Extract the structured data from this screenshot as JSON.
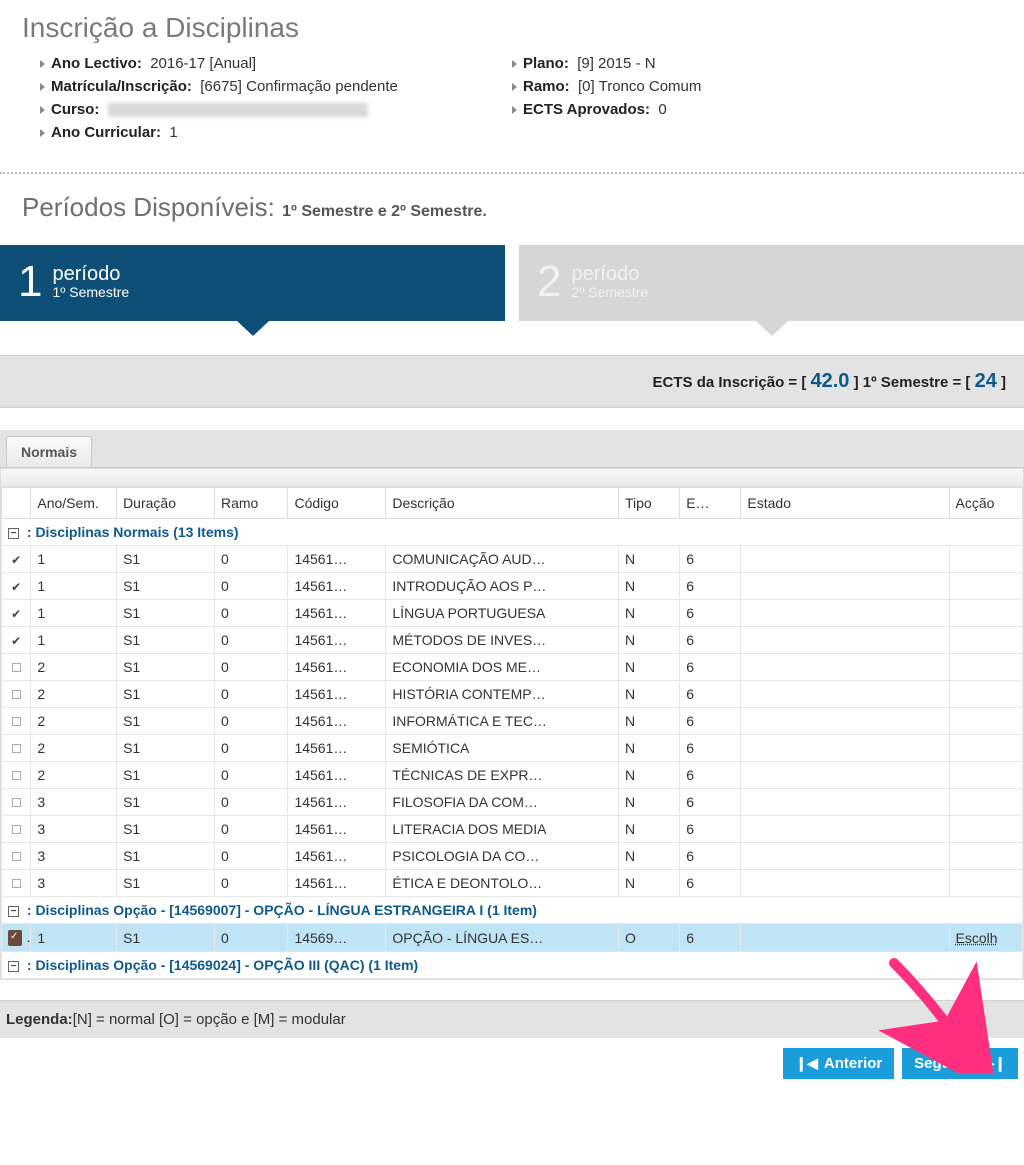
{
  "title": "Inscrição a Disciplinas",
  "info": {
    "left": {
      "ano_lectivo_label": "Ano Lectivo:",
      "ano_lectivo_value": "2016-17 [Anual]",
      "matricula_label": "Matrícula/Inscrição:",
      "matricula_value": "[6675] Confirmação pendente",
      "curso_label": "Curso:",
      "ano_curricular_label": "Ano Curricular:",
      "ano_curricular_value": "1"
    },
    "right": {
      "plano_label": "Plano:",
      "plano_value": "[9] 2015 - N",
      "ramo_label": "Ramo:",
      "ramo_value": "[0] Tronco Comum",
      "ects_aprov_label": "ECTS Aprovados:",
      "ects_aprov_value": "0"
    }
  },
  "periodos": {
    "label": "Períodos Disponíveis:",
    "text": "1º Semestre e 2º Semestre."
  },
  "tabs": [
    {
      "num": "1",
      "label": "período",
      "sub": "1º Semestre",
      "active": true
    },
    {
      "num": "2",
      "label": "período",
      "sub": "2º Semestre",
      "active": false
    }
  ],
  "ects_bar": {
    "label1": "ECTS da Inscrição = [",
    "val1": "42.0",
    "label2": "] 1º Semestre = [",
    "val2": "24",
    "label3": "]"
  },
  "subtab": "Normais",
  "columns": [
    "Ano/Sem.",
    "Duração",
    "Ramo",
    "Código",
    "Descrição",
    "Tipo",
    "E…",
    "Estado",
    "Acção"
  ],
  "groups": [
    {
      "title": ": Disciplinas Normais (13 Items)",
      "rows": [
        {
          "sel": true,
          "ano": "1",
          "dur": "S1",
          "ramo": "0",
          "cod": "14561…",
          "desc": "COMUNICAÇÃO AUD…",
          "tipo": "N",
          "ects": "6",
          "estado": "",
          "accao": ""
        },
        {
          "sel": true,
          "ano": "1",
          "dur": "S1",
          "ramo": "0",
          "cod": "14561…",
          "desc": "INTRODUÇÃO AOS P…",
          "tipo": "N",
          "ects": "6",
          "estado": "",
          "accao": ""
        },
        {
          "sel": true,
          "ano": "1",
          "dur": "S1",
          "ramo": "0",
          "cod": "14561…",
          "desc": "LÍNGUA PORTUGUESA",
          "tipo": "N",
          "ects": "6",
          "estado": "",
          "accao": ""
        },
        {
          "sel": true,
          "ano": "1",
          "dur": "S1",
          "ramo": "0",
          "cod": "14561…",
          "desc": "MÉTODOS DE INVES…",
          "tipo": "N",
          "ects": "6",
          "estado": "",
          "accao": ""
        },
        {
          "sel": false,
          "ano": "2",
          "dur": "S1",
          "ramo": "0",
          "cod": "14561…",
          "desc": "ECONOMIA DOS ME…",
          "tipo": "N",
          "ects": "6",
          "estado": "",
          "accao": ""
        },
        {
          "sel": false,
          "ano": "2",
          "dur": "S1",
          "ramo": "0",
          "cod": "14561…",
          "desc": "HISTÓRIA CONTEMP…",
          "tipo": "N",
          "ects": "6",
          "estado": "",
          "accao": ""
        },
        {
          "sel": false,
          "ano": "2",
          "dur": "S1",
          "ramo": "0",
          "cod": "14561…",
          "desc": "INFORMÁTICA E TEC…",
          "tipo": "N",
          "ects": "6",
          "estado": "",
          "accao": ""
        },
        {
          "sel": false,
          "ano": "2",
          "dur": "S1",
          "ramo": "0",
          "cod": "14561…",
          "desc": "SEMIÓTICA",
          "tipo": "N",
          "ects": "6",
          "estado": "",
          "accao": ""
        },
        {
          "sel": false,
          "ano": "2",
          "dur": "S1",
          "ramo": "0",
          "cod": "14561…",
          "desc": "TÉCNICAS DE EXPR…",
          "tipo": "N",
          "ects": "6",
          "estado": "",
          "accao": ""
        },
        {
          "sel": false,
          "ano": "3",
          "dur": "S1",
          "ramo": "0",
          "cod": "14561…",
          "desc": "FILOSOFIA DA COM…",
          "tipo": "N",
          "ects": "6",
          "estado": "",
          "accao": ""
        },
        {
          "sel": false,
          "ano": "3",
          "dur": "S1",
          "ramo": "0",
          "cod": "14561…",
          "desc": "LITERACIA DOS MEDIA",
          "tipo": "N",
          "ects": "6",
          "estado": "",
          "accao": ""
        },
        {
          "sel": false,
          "ano": "3",
          "dur": "S1",
          "ramo": "0",
          "cod": "14561…",
          "desc": "PSICOLOGIA DA CO…",
          "tipo": "N",
          "ects": "6",
          "estado": "",
          "accao": ""
        },
        {
          "sel": false,
          "ano": "3",
          "dur": "S1",
          "ramo": "0",
          "cod": "14561…",
          "desc": "ÉTICA E DEONTOLO…",
          "tipo": "N",
          "ects": "6",
          "estado": "",
          "accao": ""
        }
      ]
    },
    {
      "title": ": Disciplinas Opção - [14569007] - OPÇÃO - LÍNGUA ESTRANGEIRA I (1 Item)",
      "highlight": true,
      "rows": [
        {
          "icon": "clipboard",
          "ano": "1",
          "dur": "S1",
          "ramo": "0",
          "cod": "14569…",
          "desc": "OPÇÃO - LÍNGUA ES…",
          "tipo": "O",
          "ects": "6",
          "estado": "",
          "accao": "Escolh"
        }
      ]
    },
    {
      "title": ": Disciplinas Opção - [14569024] - OPÇÃO III (QAC) (1 Item)",
      "rows": []
    }
  ],
  "legend": {
    "label": "Legenda:",
    "text": "[N] = normal [O] = opção e [M] = modular"
  },
  "buttons": {
    "prev": "Anterior",
    "next": "Seguinte"
  }
}
